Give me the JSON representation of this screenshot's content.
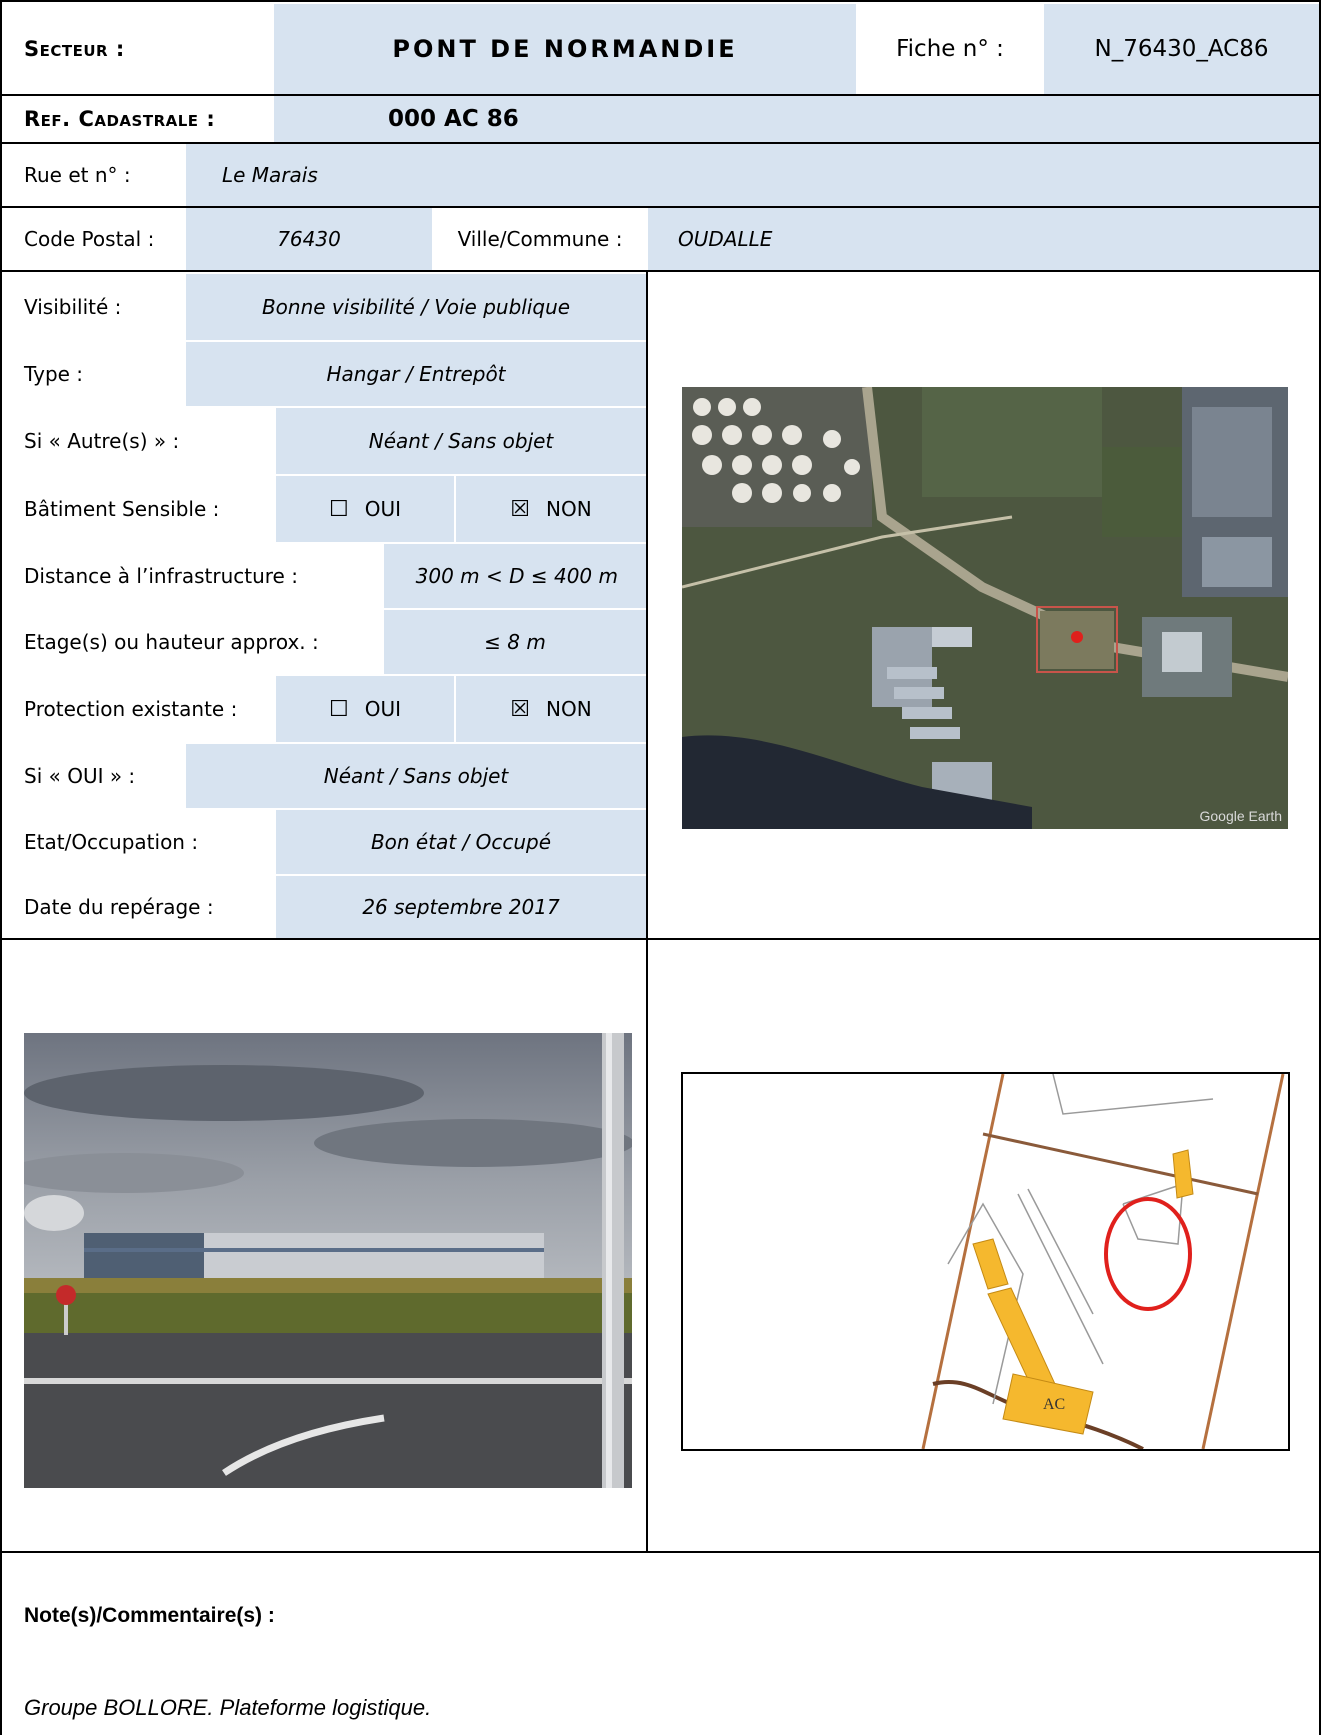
{
  "header": {
    "secteur_label": "Secteur :",
    "secteur_value": "PONT DE NORMANDIE",
    "fiche_label": "Fiche n° :",
    "fiche_value": "N_76430_AC86",
    "ref_label": "Ref. Cadastrale :",
    "ref_value": "000 AC 86"
  },
  "address": {
    "rue_label": "Rue et n° :",
    "rue_value": "Le Marais",
    "cp_label": "Code Postal :",
    "cp_value": "76430",
    "ville_label": "Ville/Commune :",
    "ville_value": "OUDALLE"
  },
  "fields": {
    "visibilite_label": "Visibilité :",
    "visibilite_value": "Bonne visibilité / Voie publique",
    "type_label": "Type :",
    "type_value": "Hangar / Entrepôt",
    "autres_label": "Si « Autre(s) » :",
    "autres_value": "Néant / Sans objet",
    "sensible_label": "Bâtiment Sensible :",
    "sensible_oui_box": "☐",
    "sensible_oui": "OUI",
    "sensible_non_box": "☒",
    "sensible_non": "NON",
    "distance_label": "Distance à l’infrastructure :",
    "distance_value": "300 m < D ≤ 400 m",
    "etage_label": "Etage(s) ou hauteur approx. :",
    "etage_value": "≤ 8 m",
    "protection_label": "Protection existante :",
    "protection_oui_box": "☐",
    "protection_oui": "OUI",
    "protection_non_box": "☒",
    "protection_non": "NON",
    "sioui_label": "Si « OUI » :",
    "sioui_value": "Néant / Sans objet",
    "etat_label": "Etat/Occupation :",
    "etat_value": "Bon état / Occupé",
    "date_label": "Date du repérage :",
    "date_value": "26 septembre 2017"
  },
  "aerial": {
    "watermark": "Google Earth"
  },
  "cadastre": {
    "parcel_label": "AC"
  },
  "notes": {
    "heading": "Note(s)/Commentaire(s) :",
    "text": "Groupe BOLLORE. Plateforme logistique."
  },
  "colors": {
    "shade": "#d7e3f0",
    "border": "#000000",
    "marker_red": "#e0201c",
    "parcel_line": "#b5703f",
    "building_yellow": "#f5b82e"
  }
}
